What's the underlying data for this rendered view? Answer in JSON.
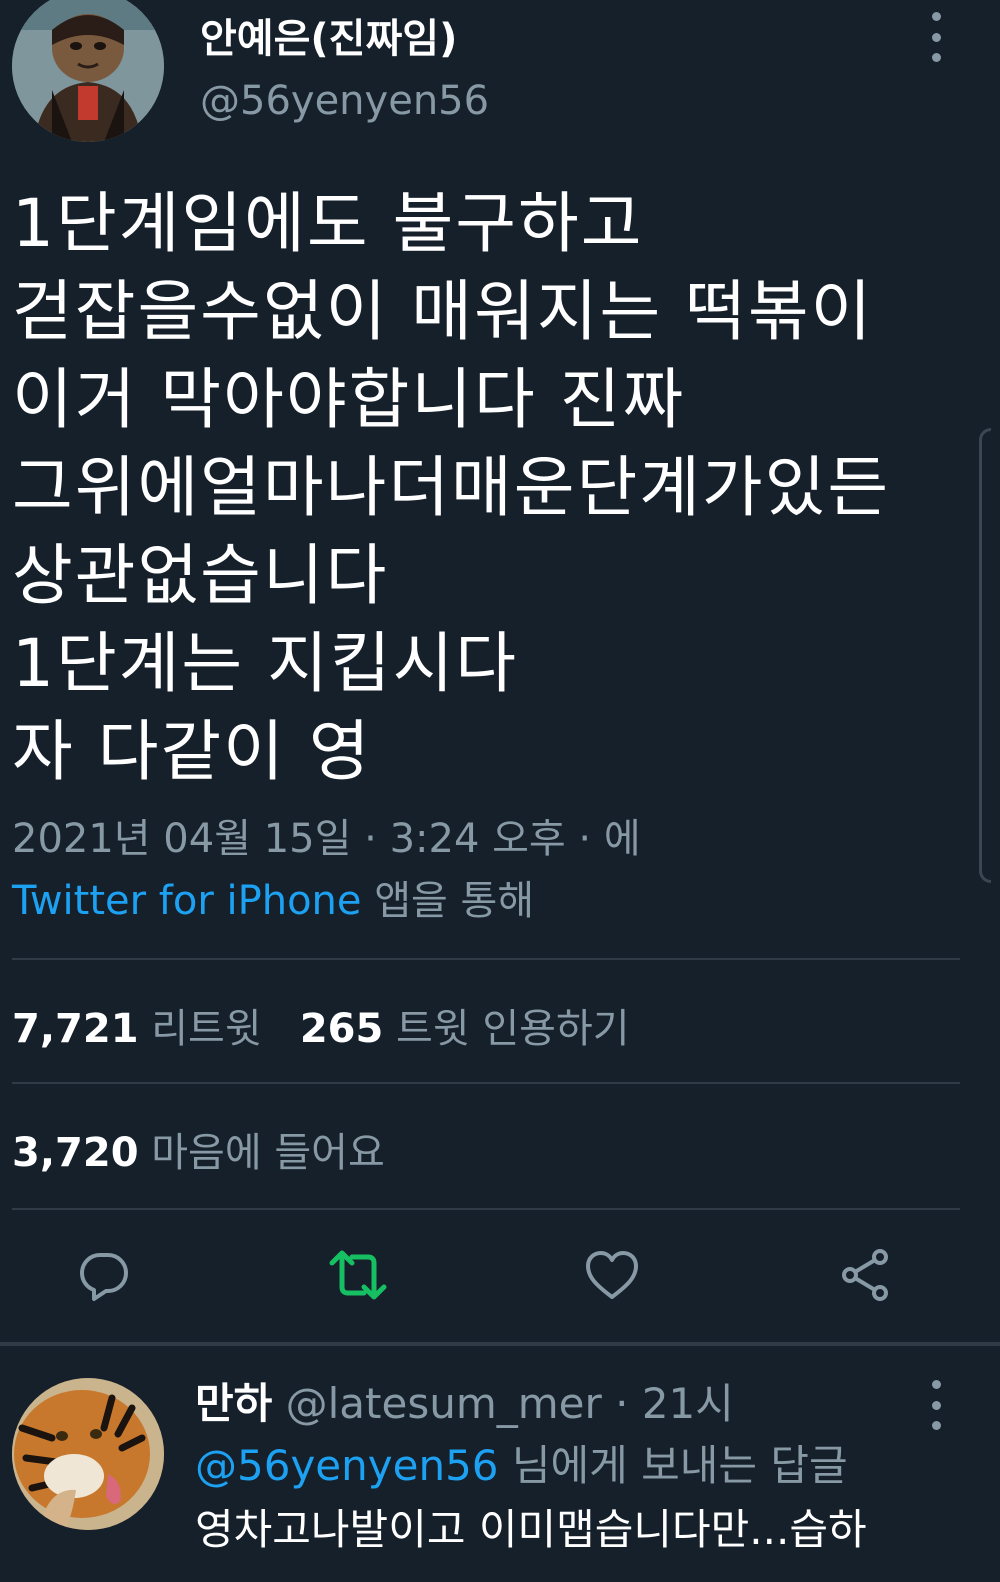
{
  "tweet": {
    "display_name": "안예은(진짜임)",
    "handle": "@56yenyen56",
    "lines": [
      "1단계임에도 불구하고",
      "걷잡을수없이 매워지는 떡볶이",
      "이거 막아야합니다 진짜",
      "그위에얼마나더매운단계가있든",
      "상관없습니다",
      "1단계는 지킵시다",
      "자 다같이 영"
    ],
    "timestamp": "2021년 04월 15일 · 3:24 오후 · 에",
    "source_app": "Twitter for iPhone",
    "source_suffix": " 앱을 통해",
    "retweets_count": "7,721",
    "retweets_label": "리트윗",
    "quotes_count": "265",
    "quotes_label": "트윗 인용하기",
    "likes_count": "3,720",
    "likes_label": "마음에 들어요"
  },
  "reply": {
    "display_name": "만하",
    "handle_time": " @latesum_mer · 21시",
    "mention": "@56yenyen56",
    "reply_to_suffix": " 님에게 보내는 답글",
    "text": "영차고나발이고 이미맵습니다만...습하"
  },
  "colors": {
    "background": "#15202b",
    "accent": "#1da1f2",
    "muted": "#8899a6",
    "retweet_active": "#17bf63"
  },
  "icons": {
    "reply": "reply-icon",
    "retweet": "retweet-icon",
    "like": "heart-icon",
    "share": "share-icon",
    "more": "more-vertical-icon"
  }
}
